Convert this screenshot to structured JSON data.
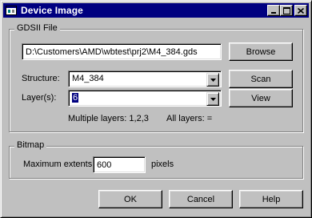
{
  "window": {
    "title": "Device Image",
    "icon": "device-image-icon",
    "controls": {
      "minimize": "minimize-icon",
      "maximize": "maximize-icon",
      "close": "close-icon"
    }
  },
  "gdsii": {
    "group_label": "GDSII File",
    "file_path": "D:\\Customers\\AMD\\wbtest\\prj2\\M4_384.gds",
    "browse_label": "Browse",
    "structure_label": "Structure:",
    "structure_value": "M4_384",
    "scan_label": "Scan",
    "layers_label": "Layer(s):",
    "layers_value": "6",
    "view_label": "View",
    "hint_multiple": "Multiple layers: 1,2,3",
    "hint_all": "All layers: ="
  },
  "bitmap": {
    "group_label": "Bitmap",
    "extents_label": "Maximum extents:",
    "extents_value": "600",
    "extents_unit": "pixels"
  },
  "buttons": {
    "ok": "OK",
    "cancel": "Cancel",
    "help": "Help"
  }
}
